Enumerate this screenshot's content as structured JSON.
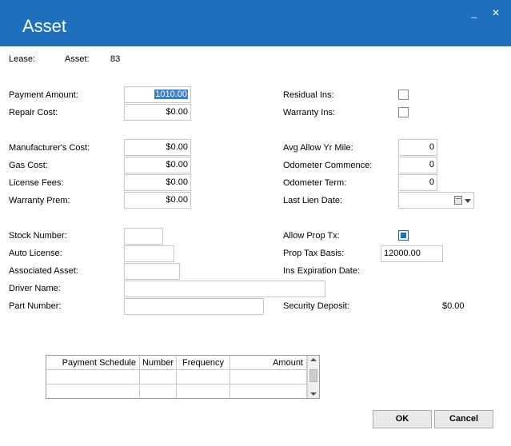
{
  "window": {
    "title": "Asset",
    "minimize": "_",
    "close": "✕"
  },
  "header": {
    "lease_label": "Lease:",
    "asset_label": "Asset:",
    "asset_value": "83"
  },
  "left": {
    "payment_amount": {
      "label": "Payment Amount:",
      "value": "1010.00"
    },
    "repair_cost": {
      "label": "Repair Cost:",
      "value": "$0.00"
    },
    "manufacturers_cost": {
      "label": "Manufacturer's Cost:",
      "value": "$0.00"
    },
    "gas_cost": {
      "label": "Gas Cost:",
      "value": "$0.00"
    },
    "license_fees": {
      "label": "License Fees:",
      "value": "$0.00"
    },
    "warranty_prem": {
      "label": "Warranty Prem:",
      "value": "$0.00"
    },
    "stock_number": {
      "label": "Stock Number:",
      "value": ""
    },
    "auto_license": {
      "label": "Auto License:",
      "value": ""
    },
    "associated_asset": {
      "label": "Associated Asset:",
      "value": ""
    },
    "driver_name": {
      "label": "Driver Name:",
      "value": ""
    },
    "part_number": {
      "label": "Part Number:",
      "value": ""
    }
  },
  "right": {
    "residual_ins": {
      "label": "Residual Ins:",
      "checked": false
    },
    "warranty_ins": {
      "label": "Warranty Ins:",
      "checked": false
    },
    "avg_allow_yr_mile": {
      "label": "Avg Allow Yr Mile:",
      "value": "0"
    },
    "odometer_commence": {
      "label": "Odometer Commence:",
      "value": "0"
    },
    "odometer_term": {
      "label": "Odometer Term:",
      "value": "0"
    },
    "last_lien_date": {
      "label": "Last Lien Date:",
      "value": ""
    },
    "allow_prop_tx": {
      "label": "Allow Prop Tx:",
      "checked": true
    },
    "prop_tax_basis": {
      "label": "Prop Tax Basis:",
      "value": "12000.00"
    },
    "ins_expiration_date": {
      "label": "Ins Expiration Date:"
    },
    "security_deposit": {
      "label": "Security Deposit:",
      "value": "$0.00"
    }
  },
  "schedule_grid": {
    "columns": [
      "Payment Schedule",
      "Number",
      "Frequency",
      "Amount"
    ],
    "rows": [
      [
        "",
        "",
        "",
        ""
      ],
      [
        "",
        "",
        "",
        ""
      ]
    ]
  },
  "buttons": {
    "ok": "OK",
    "cancel": "Cancel"
  },
  "colors": {
    "titlebar": "#1e6fbc",
    "accent_check": "#1e6fbc"
  }
}
